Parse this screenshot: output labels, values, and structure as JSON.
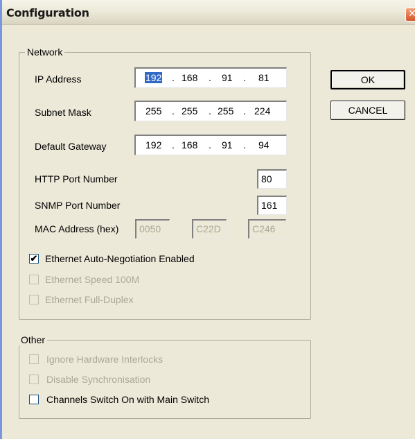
{
  "window": {
    "title": "Configuration",
    "close_glyph": "✕"
  },
  "network": {
    "legend": "Network",
    "ip_address": {
      "label": "IP Address",
      "octets": [
        "192",
        "168",
        "91",
        "81"
      ]
    },
    "subnet_mask": {
      "label": "Subnet Mask",
      "octets": [
        "255",
        "255",
        "255",
        "224"
      ]
    },
    "default_gateway": {
      "label": "Default Gateway",
      "octets": [
        "192",
        "168",
        "91",
        "94"
      ]
    },
    "dot": ".",
    "http_port": {
      "label": "HTTP Port Number",
      "value": "80"
    },
    "snmp_port": {
      "label": "SNMP Port Number",
      "value": "161"
    },
    "mac": {
      "label": "MAC Address (hex)",
      "parts": [
        "0050",
        "C22D",
        "C246"
      ]
    },
    "checks": [
      {
        "label": "Ethernet Auto-Negotiation Enabled",
        "checked": true,
        "enabled": true,
        "mark": "✔"
      },
      {
        "label": "Ethernet Speed 100M",
        "checked": false,
        "enabled": false
      },
      {
        "label": "Ethernet Full-Duplex",
        "checked": false,
        "enabled": false
      }
    ]
  },
  "other": {
    "legend": "Other",
    "checks": [
      {
        "label": "Ignore Hardware Interlocks",
        "checked": false,
        "enabled": false
      },
      {
        "label": "Disable Synchronisation",
        "checked": false,
        "enabled": false
      },
      {
        "label": "Channels Switch On with Main Switch",
        "checked": false,
        "enabled": true
      }
    ]
  },
  "buttons": {
    "ok": "OK",
    "cancel": "CANCEL"
  },
  "colors": {
    "selection": "#316ac5",
    "disabled_text": "#aca899",
    "face": "#ece9d8"
  }
}
